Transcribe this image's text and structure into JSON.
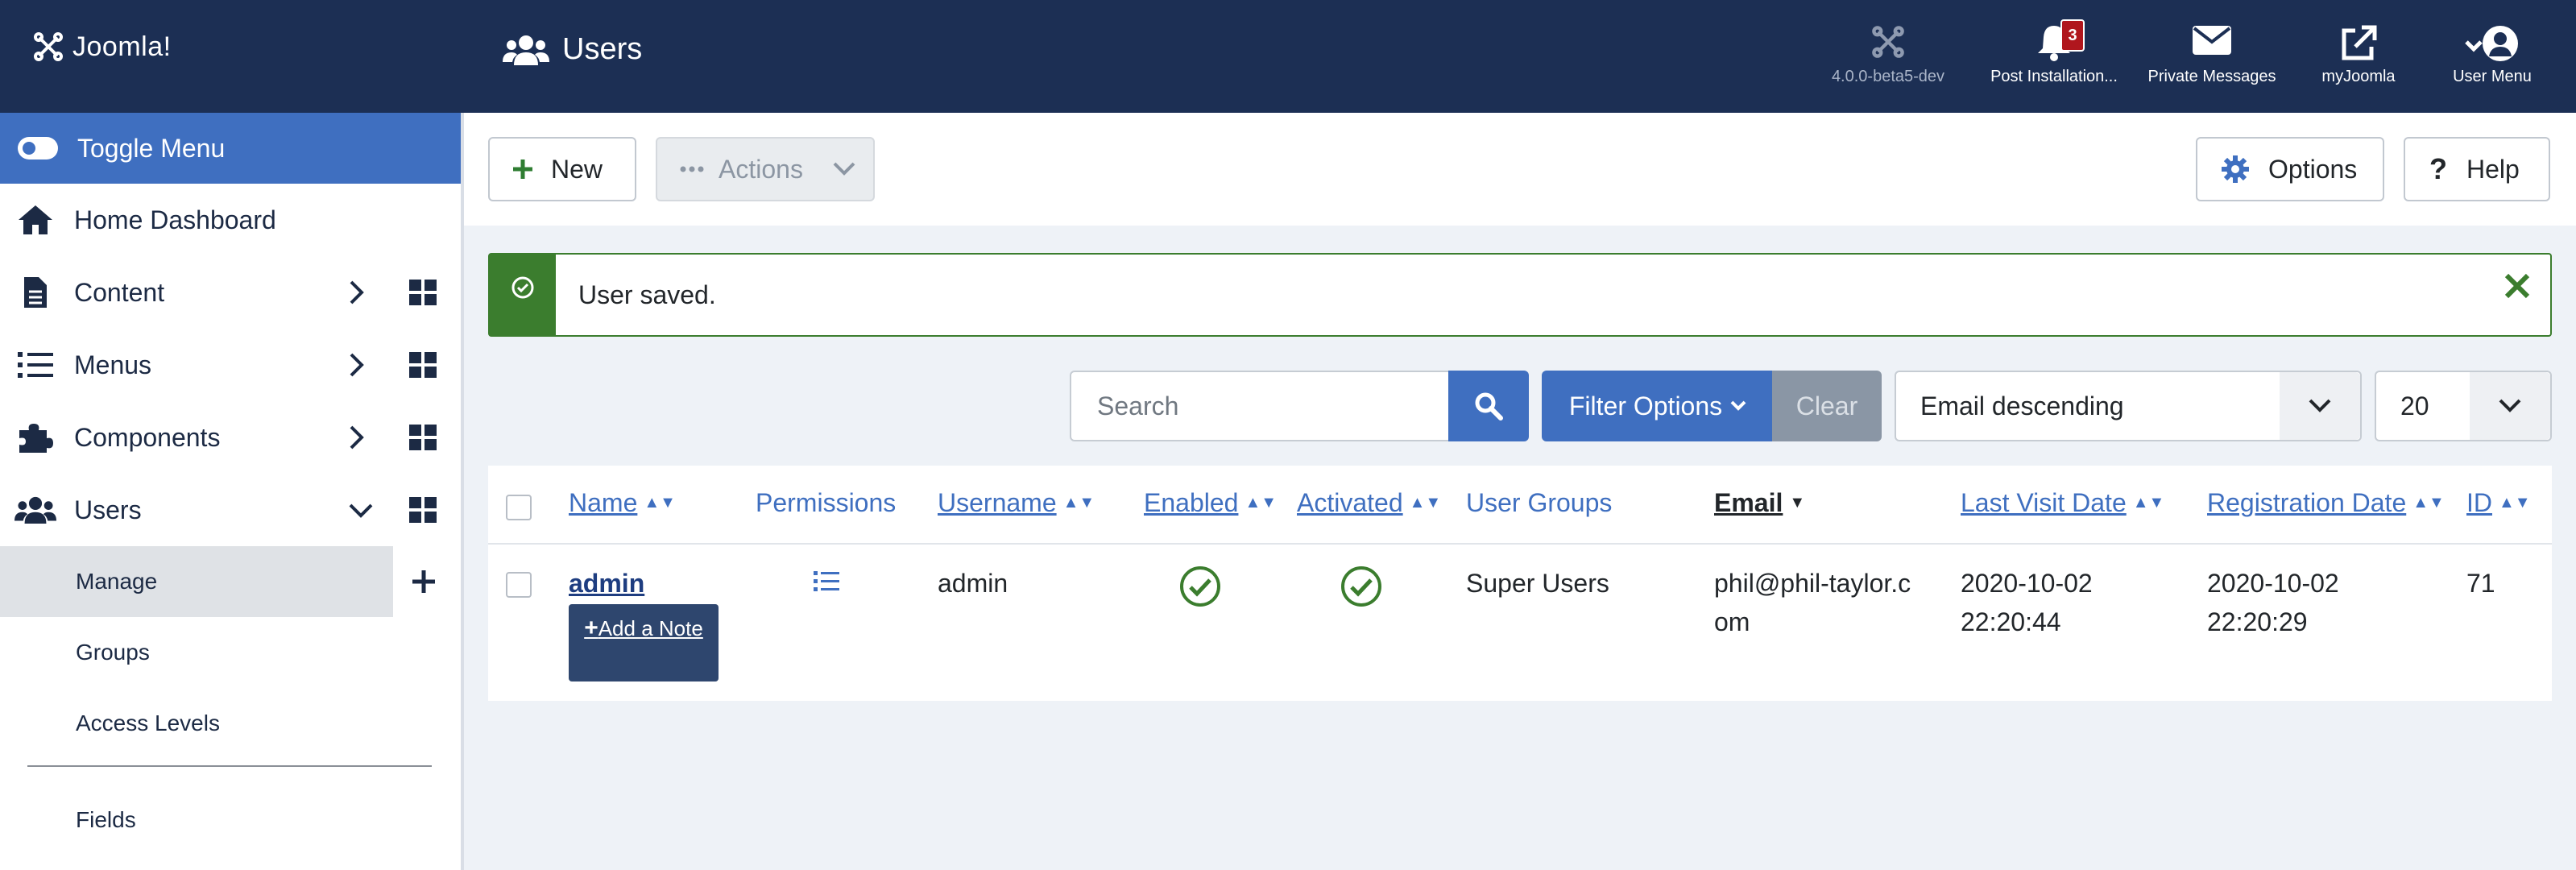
{
  "header": {
    "logo_text": "Joomla!",
    "page_title": "Users",
    "version_label": "4.0.0-beta5-dev",
    "notifications_label": "Post Installation...",
    "notifications_count": "3",
    "messages_label": "Private Messages",
    "myjoomla_label": "myJoomla",
    "user_menu_label": "User Menu"
  },
  "sidebar": {
    "toggle_label": "Toggle Menu",
    "items": [
      {
        "label": "Home Dashboard",
        "icon": "home-icon"
      },
      {
        "label": "Content",
        "icon": "file-icon"
      },
      {
        "label": "Menus",
        "icon": "list-icon"
      },
      {
        "label": "Components",
        "icon": "puzzle-icon"
      },
      {
        "label": "Users",
        "icon": "users-icon"
      }
    ],
    "sub_items": [
      "Manage",
      "Groups",
      "Access Levels",
      "Fields"
    ]
  },
  "toolbar": {
    "new_label": "New",
    "actions_label": "Actions",
    "options_label": "Options",
    "help_label": "Help"
  },
  "alert": {
    "message": "User saved."
  },
  "filters": {
    "search_placeholder": "Search",
    "filter_options_label": "Filter Options",
    "clear_label": "Clear",
    "sort_value": "Email descending",
    "limit_value": "20"
  },
  "table": {
    "columns": {
      "name": "Name",
      "permissions": "Permissions",
      "username": "Username",
      "enabled": "Enabled",
      "activated": "Activated",
      "user_groups": "User Groups",
      "email": "Email",
      "last_visit": "Last Visit Date",
      "registration": "Registration Date",
      "id": "ID"
    },
    "rows": [
      {
        "name": "admin",
        "add_note_label": "Add a Note",
        "username": "admin",
        "user_groups": "Super Users",
        "email_line1": "phil@phil-taylor.c",
        "email_line2": "om",
        "last_visit_date": "2020-10-02",
        "last_visit_time": "22:20:44",
        "registration_date": "2020-10-02",
        "registration_time": "22:20:29",
        "id": "71"
      }
    ]
  },
  "colors": {
    "header_bg": "#1c2f54",
    "primary": "#3f6fc0",
    "success": "#3b7d2e"
  }
}
